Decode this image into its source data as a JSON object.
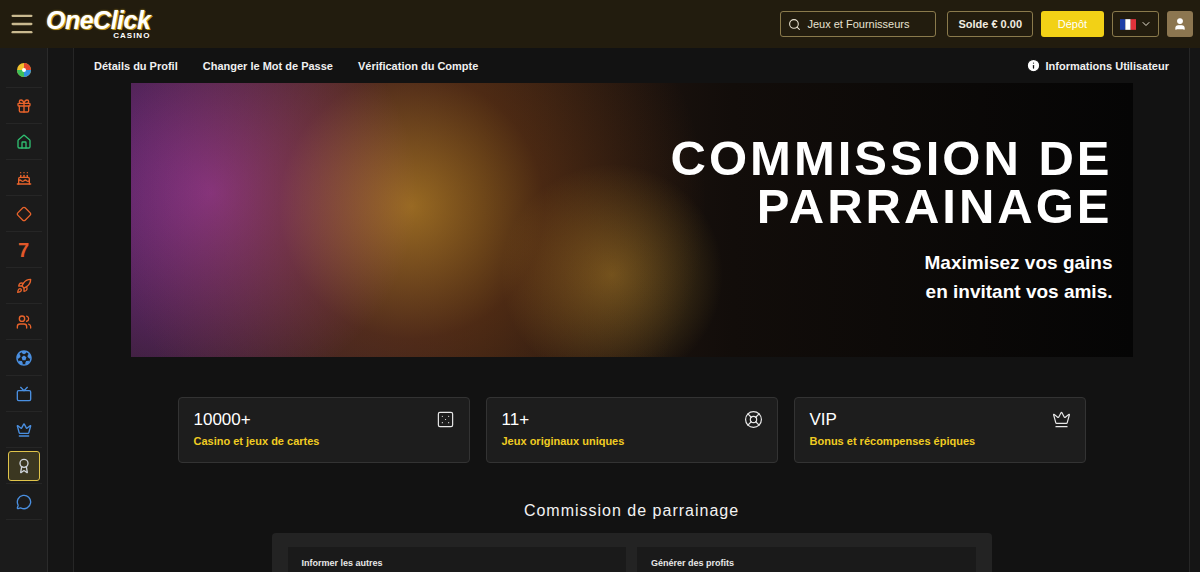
{
  "header": {
    "logo": {
      "name": "OneClick",
      "sub": "CASINO"
    },
    "search": {
      "placeholder": "Jeux et Fournisseurs"
    },
    "balance": "Solde € 0.00",
    "deposit": "Dépôt"
  },
  "sidebar": {
    "items": [
      {
        "selected": false
      },
      {
        "selected": false
      },
      {
        "selected": false
      },
      {
        "selected": false
      },
      {
        "selected": false
      },
      {
        "selected": false,
        "glyph": "7"
      },
      {
        "selected": false
      },
      {
        "selected": false
      },
      {
        "selected": false
      },
      {
        "selected": false
      },
      {
        "selected": false
      },
      {
        "selected": true
      },
      {
        "selected": false
      }
    ]
  },
  "profile_tabs": [
    "Détails du Profil",
    "Changer le Mot de Passe",
    "Vérification du Compte"
  ],
  "user_info": "Informations Utilisateur",
  "banner": {
    "title_lines": [
      "COMMISSION DE",
      "PARRAINAGE"
    ],
    "subtitle_lines": [
      "Maximisez vos gains",
      "en invitant vos amis."
    ]
  },
  "stats": [
    {
      "value": "10000+",
      "label": "Casino et jeux de cartes"
    },
    {
      "value": "11+",
      "label": "Jeux originaux uniques"
    },
    {
      "value": "VIP",
      "label": "Bonus et récompenses épiques"
    }
  ],
  "section_title": "Commission de parrainage",
  "steps": [
    {
      "title": "Informer les autres"
    },
    {
      "title": "Générer des profits"
    }
  ]
}
